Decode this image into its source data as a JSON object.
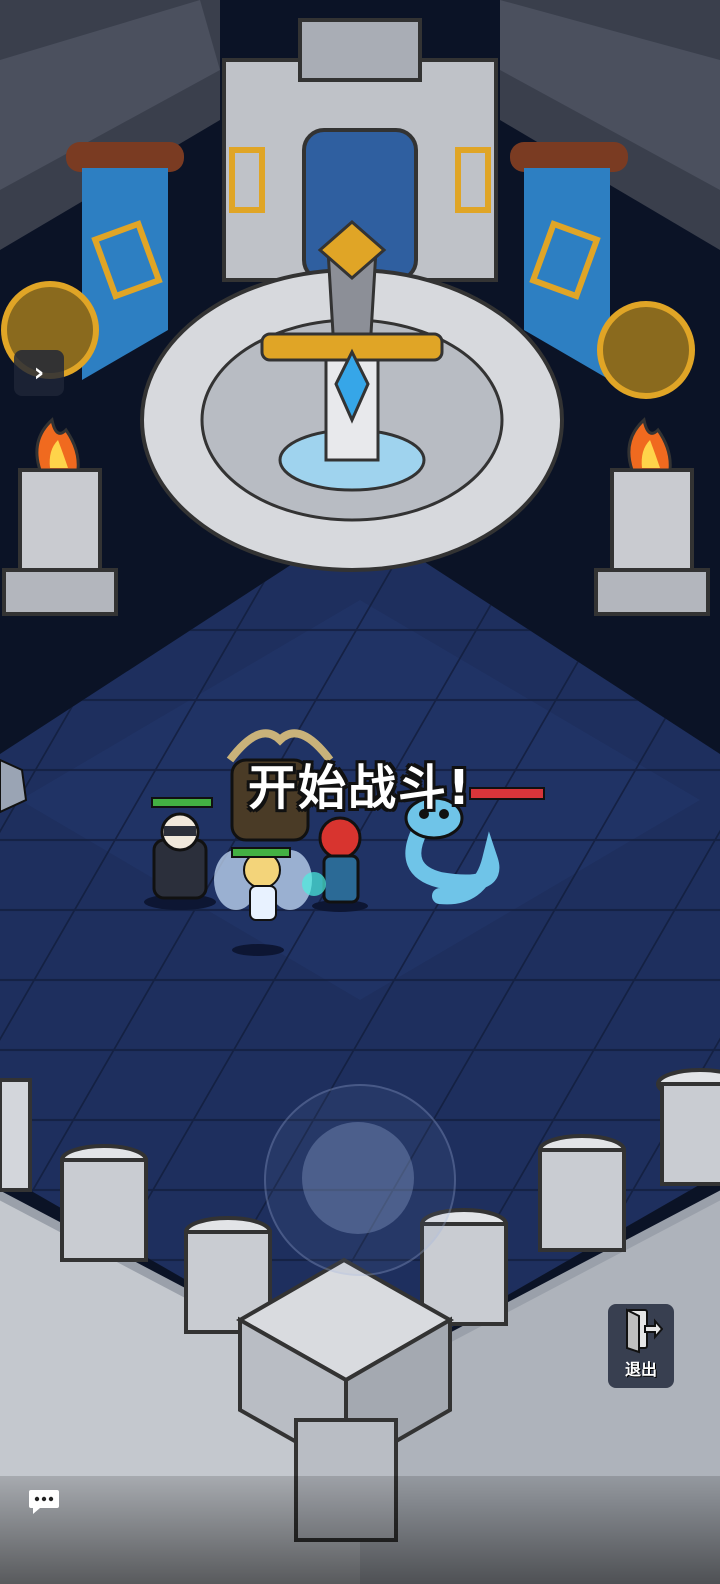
{
  "hud": {
    "battle_text": "开始战斗!",
    "exit_label": "退出"
  },
  "units": {
    "ally_health": 1.0,
    "enemy_health": 1.0
  },
  "icons": {
    "expand": "chevron-right-icon",
    "exit": "exit-door-icon",
    "chat": "chat-bubble-icon"
  },
  "colors": {
    "ally_hp": "#43b043",
    "enemy_hp": "#d8353a",
    "floor": "#1c2d5a",
    "stone": "#c9cbd0",
    "banner": "#2d7fc2",
    "gold": "#e0a526"
  }
}
